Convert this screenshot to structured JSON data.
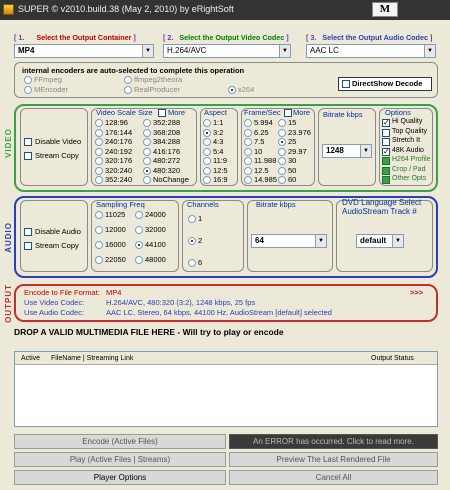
{
  "window": {
    "title": "SUPER © v2010.build.38 (May 2, 2010) by eRightSoft",
    "m_button": "M"
  },
  "headers": {
    "container": {
      "num": "[ 1.",
      "text": "Select the Output Container",
      "close": "]"
    },
    "video_codec": {
      "num": "[ 2.",
      "text": "Select the Output Video Codec",
      "close": "]"
    },
    "audio_codec": {
      "num": "[ 3.",
      "text": "Select the Output Audio Codec",
      "close": "]"
    }
  },
  "combos": {
    "container": "MP4",
    "video_codec": "H.264/AVC",
    "audio_codec": "AAC LC"
  },
  "encoders": {
    "title": "internal encoders are auto-selected to complete this operation",
    "items": [
      "FFmpeg",
      "MEncoder",
      "ffmpeg2theora",
      "RealProducer",
      "x264"
    ],
    "directshow": "DirectShow Decode"
  },
  "video": {
    "section_label": "VIDEO",
    "disable": "Disable Video",
    "stream_copy": "Stream Copy",
    "scale_title": "Video Scale Size",
    "more": "More",
    "scale_col1": [
      "128:96",
      "176:144",
      "240:176",
      "240:192",
      "320:176",
      "320:240",
      "352:240"
    ],
    "scale_col2": [
      "352:288",
      "368:208",
      "384:288",
      "416:176",
      "480:272",
      "480:320",
      "NoChange"
    ],
    "aspect_title": "Aspect",
    "aspect": [
      "1:1",
      "3:2",
      "4:3",
      "5:4",
      "11:9",
      "12:5",
      "16:9"
    ],
    "fps_title": "Frame/Sec",
    "fps_col1": [
      "5.994",
      "6.25",
      "7.5",
      "10",
      "11.988",
      "12.5",
      "14.985"
    ],
    "fps_col2": [
      "15",
      "23.976",
      "25",
      "29.97",
      "30",
      "50",
      "60"
    ],
    "bitrate_title": "Bitrate  kbps",
    "bitrate_value": "1248",
    "options_title": "Options",
    "options": [
      "Hi Quality",
      "Top Quality",
      "Stretch It",
      "48K Audio",
      "H264 Profile",
      "Crop / Pad",
      "Other Opts"
    ]
  },
  "audio": {
    "section_label": "AUDIO",
    "disable": "Disable Audio",
    "stream_copy": "Stream Copy",
    "freq_title": "Sampling Freq",
    "freq_col1": [
      "11025",
      "12000",
      "16000",
      "22050"
    ],
    "freq_col2": [
      "24000",
      "32000",
      "44100",
      "48000"
    ],
    "channels_title": "Channels",
    "channels": [
      "1",
      "2",
      "6"
    ],
    "bitrate_title": "Bitrate  kbps",
    "bitrate_value": "64",
    "dvd_title": "DVD Language Select",
    "dvd_subtitle": "AudioStream  Track #",
    "dvd_value": "default"
  },
  "output": {
    "section_label": "OUTPUT",
    "rows": [
      {
        "label": "Encode to File Format:",
        "value": "MP4"
      },
      {
        "label": "Use Video Codec:",
        "value": "H.264/AVC,  480:320 (3:2),  1248 kbps,  25 fps"
      },
      {
        "label": "Use Audio Codec:",
        "value": "AAC LC,  Stereo,  64 kbps,  44100 Hz,  AudioStream [default] selected"
      }
    ],
    "more": ">>>"
  },
  "drop_text": "DROP A VALID MULTIMEDIA FILE HERE - Will try to play or encode",
  "table": {
    "col_active": "Active",
    "col_filename": "FileName  |  Streaming Link",
    "col_status": "Output Status"
  },
  "buttons": {
    "encode": "Encode (Active Files)",
    "error": "An ERROR has occurred. Click to read more.",
    "play": "Play (Active Files | Streams)",
    "preview": "Preview The Last Rendered File",
    "player_options": "Player Options",
    "cancel_all": "Cancel All"
  },
  "colors": {
    "video": "#3aa04a",
    "audio": "#2a3fb8",
    "output": "#c03030",
    "header_red": "#c00000",
    "header_green": "#008000"
  }
}
